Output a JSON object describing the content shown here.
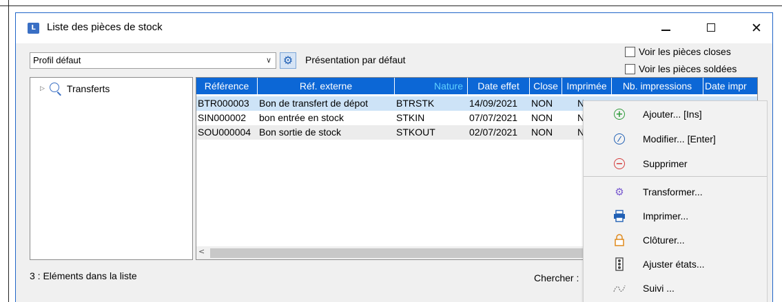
{
  "window": {
    "title": "Liste des pièces de stock",
    "app_icon_glyph": "L",
    "controls": {
      "minimize": "—",
      "maximize": "☐",
      "close": "✕"
    }
  },
  "toolbar": {
    "profile_value": "Profil défaut",
    "presentation_label": "Présentation par défaut",
    "checkboxes": [
      {
        "label": "Voir les pièces closes",
        "checked": false
      },
      {
        "label": "Voir les pièces soldées",
        "checked": false
      }
    ]
  },
  "tree": {
    "items": [
      {
        "label": "Transferts",
        "icon": "magnifier-icon"
      }
    ]
  },
  "grid": {
    "columns": [
      "Référence",
      "Réf. externe",
      "Nature",
      "Date effet",
      "Close",
      "Imprimée",
      "Nb. impressions",
      "Date impr"
    ],
    "rows": [
      [
        "BTR000003",
        "Bon de transfert de dépot",
        "BTRSTK",
        "14/09/2021",
        "NON",
        "N",
        "",
        ""
      ],
      [
        "SIN000002",
        "bon entrée en stock",
        "STKIN",
        "07/07/2021",
        "NON",
        "N",
        "",
        ""
      ],
      [
        "SOU000004",
        "Bon sortie de stock",
        "STKOUT",
        "02/07/2021",
        "NON",
        "N",
        "",
        ""
      ]
    ],
    "selected_row": 0
  },
  "status": {
    "count_text": "3 : Eléments dans la liste",
    "search_label": "Chercher :"
  },
  "context_menu": {
    "items": [
      {
        "label": "Ajouter... [Ins]",
        "icon": "add-icon",
        "color": "#2e9a3a"
      },
      {
        "label": "Modifier... [Enter]",
        "icon": "edit-icon",
        "color": "#1f5fb4"
      },
      {
        "label": "Supprimer",
        "icon": "delete-icon",
        "color": "#d43c3c"
      },
      {
        "label": "Transformer...",
        "icon": "transform-gears-icon",
        "color": "#7a5bd0"
      },
      {
        "label": "Imprimer...",
        "icon": "printer-icon",
        "color": "#1f5fb4"
      },
      {
        "label": "Clôturer...",
        "icon": "lock-icon",
        "color": "#e08a1c"
      },
      {
        "label": "Ajuster états...",
        "icon": "traffic-light-icon",
        "color": "#4a4a4a"
      },
      {
        "label": "Suivi ...",
        "icon": "tracking-icon",
        "color": "#7a7a7a"
      }
    ]
  },
  "colors": {
    "header_bg": "#0c67d6",
    "selected_row_bg": "#cde3f7",
    "window_border": "#1e64c8"
  }
}
